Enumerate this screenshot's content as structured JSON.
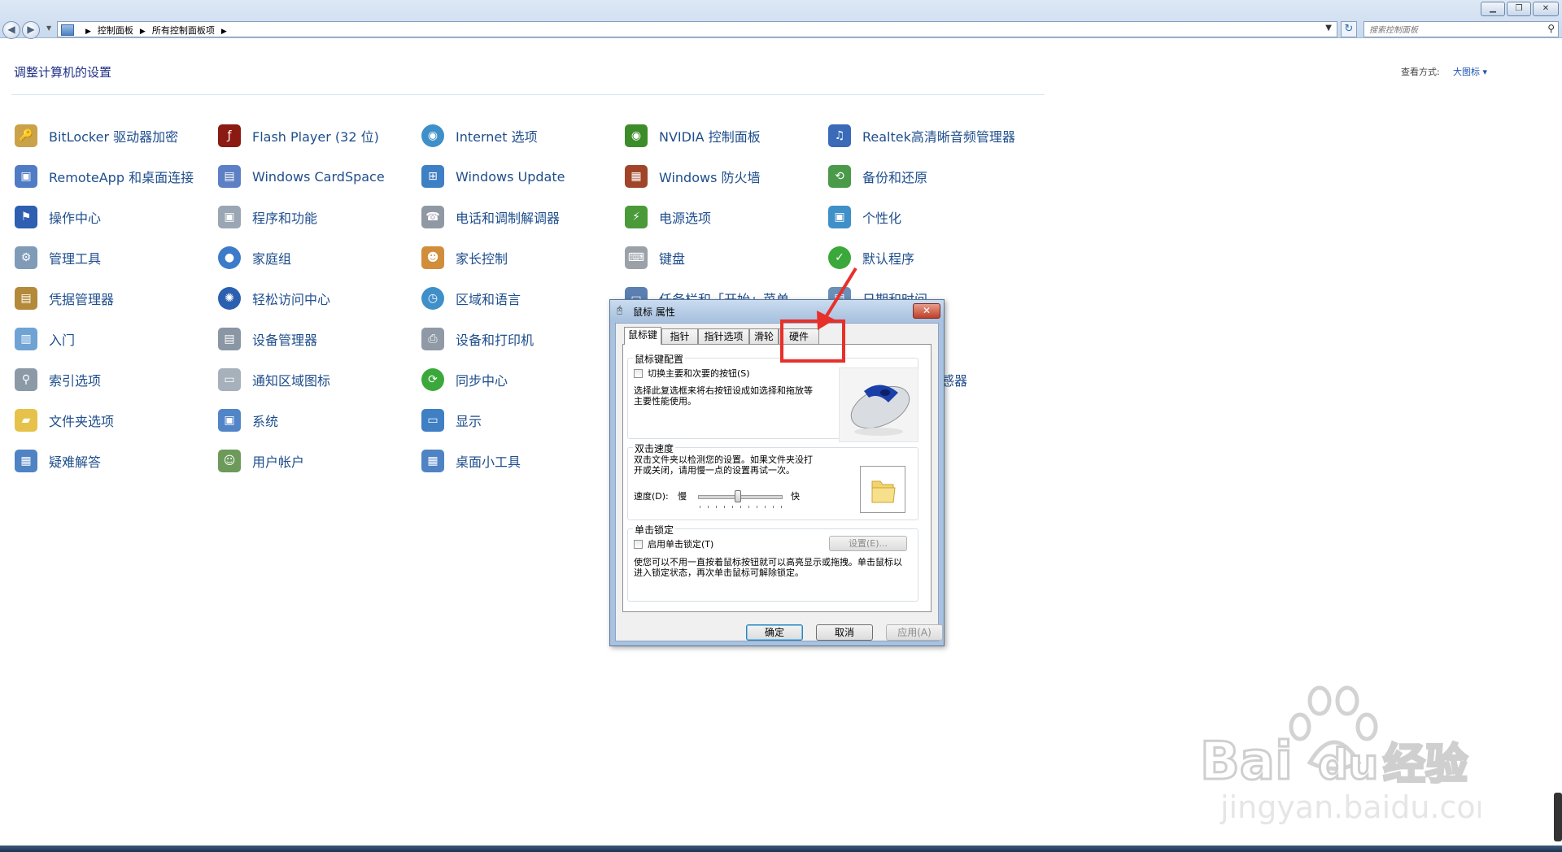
{
  "window": {
    "minimize_icon": "minimize-icon",
    "maximize_icon": "maximize-icon",
    "close_icon": "close-icon"
  },
  "address_bar": {
    "breadcrumb": [
      "控制面板",
      "所有控制面板项"
    ],
    "search_placeholder": "搜索控制面板"
  },
  "header": {
    "title": "调整计算机的设置",
    "view_label": "查看方式:",
    "view_value": "大图标 ▾"
  },
  "items": {
    "bitlocker": "BitLocker 驱动器加密",
    "flash": "Flash Player (32 位)",
    "internet": "Internet 选项",
    "nvidia": "NVIDIA 控制面板",
    "realtek": "Realtek高清晰音频管理器",
    "remoteapp": "RemoteApp 和桌面连接",
    "cardspace": "Windows CardSpace",
    "update": "Windows Update",
    "firewall": "Windows 防火墙",
    "backup": "备份和还原",
    "action_center": "操作中心",
    "programs": "程序和功能",
    "phone_modem": "电话和调制解调器",
    "power": "电源选项",
    "personalize": "个性化",
    "admin_tools": "管理工具",
    "homegroup": "家庭组",
    "parental": "家长控制",
    "keyboard": "键盘",
    "default_programs": "默认程序",
    "credential": "凭据管理器",
    "ease_access": "轻松访问中心",
    "region": "区域和语言",
    "taskbar_start": "任务栏和「开始」菜单",
    "date_time": "日期和时间",
    "getting_started": "入门",
    "device_manager": "设备管理器",
    "devices_printers": "设备和打印机",
    "indexing": "索引选项",
    "notification_icons": "通知区域图标",
    "sync_center": "同步中心",
    "sensor_suffix": "感器",
    "folder_options": "文件夹选项",
    "system": "系统",
    "display": "显示",
    "troubleshoot": "疑难解答",
    "user_accounts": "用户帐户",
    "gadgets": "桌面小工具"
  },
  "dialog": {
    "title": "鼠标 属性",
    "tabs": [
      "鼠标键",
      "指针",
      "指针选项",
      "滑轮",
      "硬件"
    ],
    "active_tab": "鼠标键",
    "button_config": {
      "group_title": "鼠标键配置",
      "checkbox_label": "切换主要和次要的按钮(S)",
      "description": "选择此复选框来将右按钮设成如选择和拖放等主要性能使用。"
    },
    "double_click": {
      "group_title": "双击速度",
      "description": "双击文件夹以检测您的设置。如果文件夹没打开或关闭，请用慢一点的设置再试一次。",
      "speed_label": "速度(D):",
      "slow_label": "慢",
      "fast_label": "快",
      "speed_level": 0.48
    },
    "click_lock": {
      "group_title": "单击锁定",
      "checkbox_label": "启用单击锁定(T)",
      "settings_button": "设置(E)...",
      "description": "使您可以不用一直按着鼠标按钮就可以高亮显示或拖拽。单击鼠标以进入锁定状态，再次单击鼠标可解除锁定。"
    },
    "buttons": {
      "ok": "确定",
      "cancel": "取消",
      "apply": "应用(A)"
    }
  },
  "watermark": {
    "brand": "Bai",
    "brand_suffix": "du",
    "brand_cn": "经验",
    "url": "jingyan.baidu.com"
  },
  "colors": {
    "link": "#1e4e8c",
    "title": "#1e3287",
    "annotation": "#e8302a"
  }
}
